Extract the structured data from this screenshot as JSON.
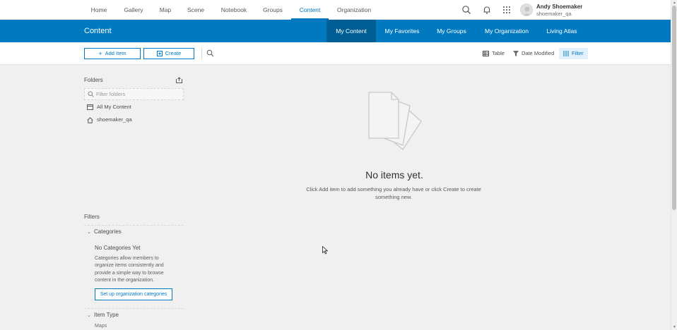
{
  "topnav": {
    "links": [
      "Home",
      "Gallery",
      "Map",
      "Scene",
      "Notebook",
      "Groups",
      "Content",
      "Organization"
    ],
    "active": "Content",
    "user": {
      "name": "Andy Shoemaker",
      "handle": "shoemaker_qa"
    },
    "icons": [
      "search-icon",
      "bell-icon",
      "app-launcher-icon"
    ]
  },
  "header": {
    "title": "Content",
    "tabs": [
      "My Content",
      "My Favorites",
      "My Groups",
      "My Organization",
      "Living Atlas"
    ],
    "active_tab": "My Content",
    "accent_color": "#0079c1"
  },
  "toolbar": {
    "add_item_label": "Add Item",
    "create_label": "Create",
    "view_label": "Table",
    "sort_label": "Date Modified",
    "filter_label": "Filter"
  },
  "sidebar": {
    "folders_title": "Folders",
    "filter_placeholder": "Filter folders",
    "folders": [
      {
        "label": "All My Content",
        "icon": "all-content-icon"
      },
      {
        "label": "shoemaker_qa",
        "icon": "home-icon"
      }
    ],
    "filters_title": "Filters",
    "categories_header": "Categories",
    "no_categories_title": "No Categories Yet",
    "no_categories_desc": "Categories allow members to organize items consistently and provide a simple way to browse content in the organization.",
    "setup_button": "Set up organization categories",
    "item_type_header": "Item Type",
    "item_type_first": "Maps"
  },
  "empty_state": {
    "title": "No items yet.",
    "description": "Click Add item to add something you already have or click Create to create something new."
  }
}
